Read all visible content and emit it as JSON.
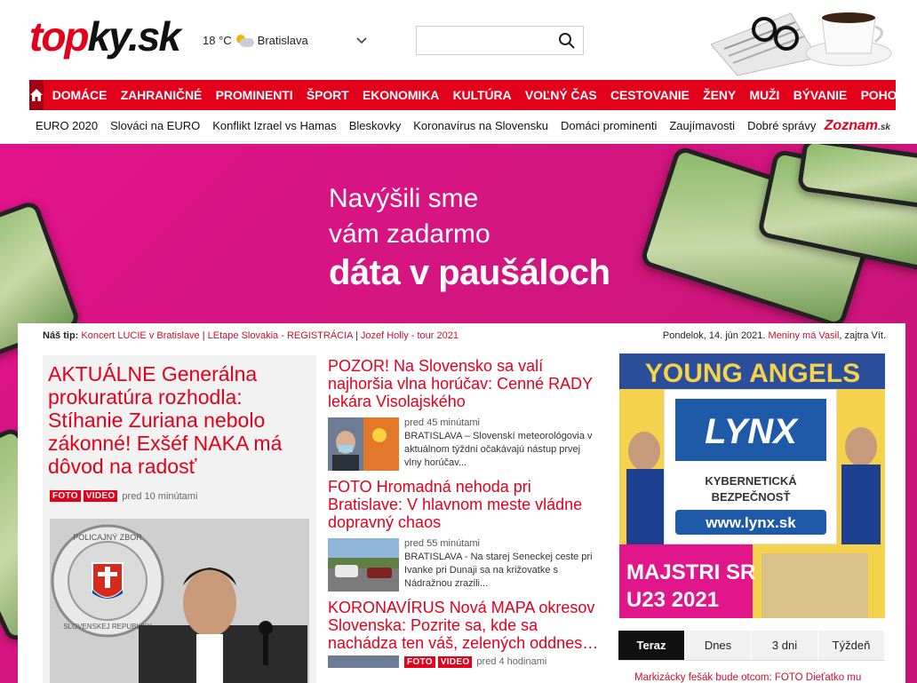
{
  "header": {
    "logo_part1": "top",
    "logo_part2": "ky.sk",
    "weather_temp": "18 °C",
    "weather_icon": "partly-cloudy-icon",
    "weather_city": "Bratislava",
    "search_placeholder": ""
  },
  "nav": {
    "items": [
      "DOMÁCE",
      "ZAHRANIČNÉ",
      "PROMINENTI",
      "ŠPORT",
      "EKONOMIKA",
      "KULTÚRA",
      "VOĽNÝ ČAS",
      "CESTOVANIE",
      "ŽENY",
      "MUŽI",
      "BÝVANIE",
      "POHODO"
    ]
  },
  "subnav": {
    "items": [
      "EURO 2020",
      "Slováci na EURO",
      "Konflikt Izrael vs Hamas",
      "Bleskovky",
      "Koronavírus na Slovensku",
      "Domáci prominenti",
      "Zaujímavosti",
      "Dobré správy"
    ],
    "partner_a": "Zoznam",
    "partner_b": ".sk"
  },
  "banner": {
    "line1": "Navýšili sme",
    "line2": "vám zadarmo",
    "line3": "dáta v paušáloch"
  },
  "tips": {
    "label": "Náš tip:",
    "link1": "Koncert LUCIE v Bratislave",
    "sep": "|",
    "link2": "LEtape Slovakia - REGISTRÁCIA",
    "link3": "Jozef Holly - tour 2021"
  },
  "date": {
    "text": "Pondelok, 14. jún 2021.",
    "nameday": "Meniny má Vasil",
    "tomorrow": ", zajtra Vít."
  },
  "main_article": {
    "title": "AKTUÁLNE Generálna prokuratúra rozhodla: Stíhanie Zuriana nebolo zákonné! Exšéf NAKA má dôvod na radosť",
    "badge1": "FOTO",
    "badge2": "VIDEO",
    "time": "pred 10 minútami",
    "photo_caption_top": "POLICAJNÝ ZBOR",
    "photo_caption_bottom": "SLOVENSKEJ REPUBLIKY"
  },
  "articles": [
    {
      "title": "POZOR! Na Slovensko sa valí najhoršia vlna horúčav: Cenné RADY lekára Visolajského",
      "time": "pred 45 minútami",
      "desc": "BRATISLAVA – Slovenskí meteorológovia v aktuálnom týždni očakávajú nástup prvej vlny horúčav..."
    },
    {
      "title": "FOTO Hromadná nehoda pri Bratislave: V hlavnom meste vládne dopravný chaos",
      "time": "pred 55 minútami",
      "desc": "BRATISLAVA - Na starej Seneckej ceste pri Ivanke pri Dunaji sa na križovatke s Nádražnou zrazili..."
    },
    {
      "title": "KORONAVÍRUS Nová MAPA okresov Slovenska: Pozrite sa, kde sa nachádza ten váš, zelených oddnes…",
      "badge1": "FOTO",
      "badge2": "VIDEO",
      "time": "pred 4 hodinami"
    }
  ],
  "ad": {
    "top_text": "YOUNG ANGELS",
    "brand": "LYNX",
    "sub1": "KYBERNETICKÁ",
    "sub2": "BEZPEČNOSŤ",
    "url": "www.lynx.sk",
    "bottom1": "MAJSTRI SR",
    "bottom2": "U23 2021"
  },
  "tabs": {
    "items": [
      "Teraz",
      "Dnes",
      "3 dni",
      "Týždeň"
    ]
  },
  "teaser": "Markizácky fešák bude otcom: FOTO Dieťatko mu"
}
